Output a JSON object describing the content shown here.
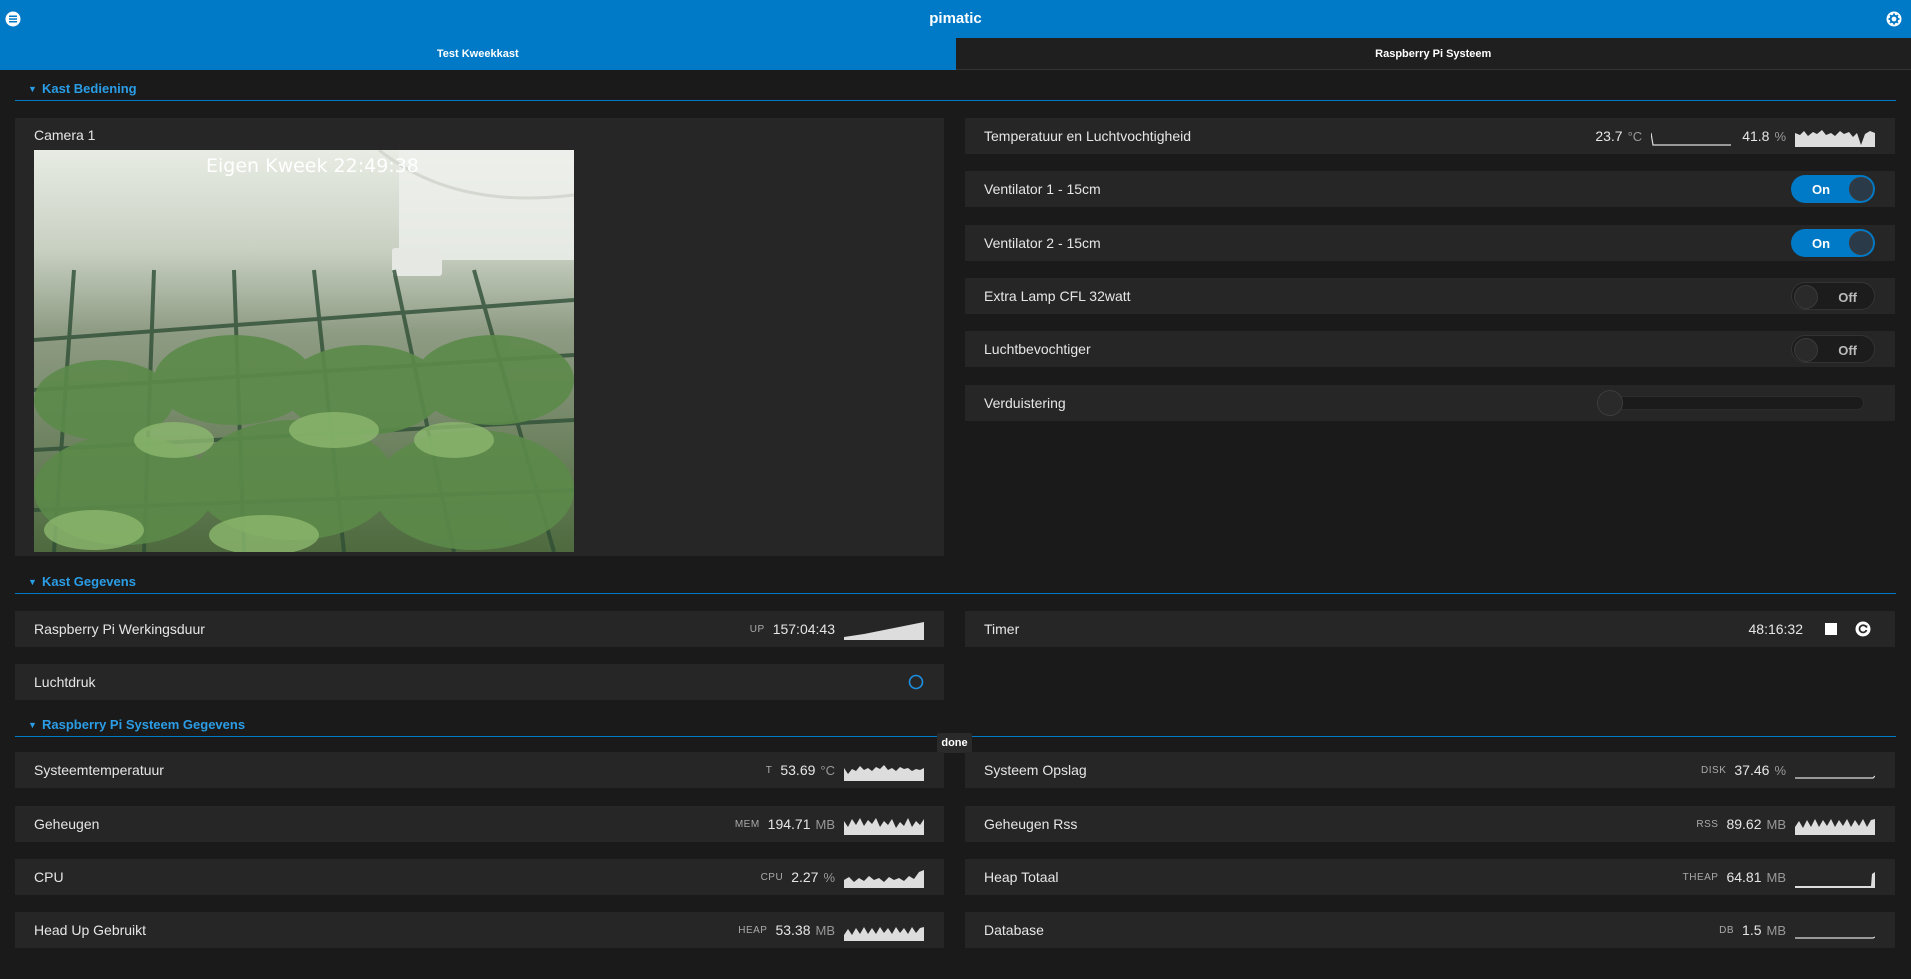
{
  "header": {
    "title": "pimatic",
    "menu_icon": "menu-icon",
    "settings_icon": "gear-icon"
  },
  "tabs": [
    {
      "label": "Test Kweekkast",
      "active": true
    },
    {
      "label": "Raspberry Pi Systeem",
      "active": false
    }
  ],
  "sections": {
    "kast_bediening": "Kast Bediening",
    "kast_gegevens": "Kast Gegevens",
    "pi_gegevens": "Raspberry Pi Systeem Gegevens"
  },
  "camera": {
    "label": "Camera 1",
    "overlay_text": "Eigen Kweek  22:49:38"
  },
  "temp_hum": {
    "label": "Temperatuur en Luchtvochtigheid",
    "temperature": "23.7",
    "temp_unit": "°C",
    "humidity": "41.8",
    "hum_unit": "%"
  },
  "switches": [
    {
      "label": "Ventilator 1 - 15cm",
      "state": "On"
    },
    {
      "label": "Ventilator 2 - 15cm",
      "state": "On"
    },
    {
      "label": "Extra Lamp CFL 32watt",
      "state": "Off"
    },
    {
      "label": "Luchtbevochtiger",
      "state": "Off"
    }
  ],
  "dimmer": {
    "label": "Verduistering",
    "level": 0
  },
  "uptime": {
    "label": "Raspberry Pi Werkingsduur",
    "acronym": "UP",
    "value": "157:04:43"
  },
  "timer": {
    "label": "Timer",
    "value": "48:16:32",
    "stop_icon": "stop-icon",
    "reset_icon": "refresh-icon"
  },
  "luchtdruk": {
    "label": "Luchtdruk",
    "icon": "loading-circle-icon"
  },
  "tooltip": {
    "text": "done"
  },
  "system_left": [
    {
      "label": "Systeemtemperatuur",
      "acronym": "T",
      "value": "53.69",
      "unit": "°C"
    },
    {
      "label": "Geheugen",
      "acronym": "MEM",
      "value": "194.71",
      "unit": "MB"
    },
    {
      "label": "CPU",
      "acronym": "CPU",
      "value": "2.27",
      "unit": "%"
    },
    {
      "label": "Head Up Gebruikt",
      "acronym": "HEAP",
      "value": "53.38",
      "unit": "MB"
    }
  ],
  "system_right": [
    {
      "label": "Systeem Opslag",
      "acronym": "DISK",
      "value": "37.46",
      "unit": "%"
    },
    {
      "label": "Geheugen Rss",
      "acronym": "RSS",
      "value": "89.62",
      "unit": "MB"
    },
    {
      "label": "Heap Totaal",
      "acronym": "THEAP",
      "value": "64.81",
      "unit": "MB"
    },
    {
      "label": "Database",
      "acronym": "DB",
      "value": "1.5",
      "unit": "MB"
    }
  ],
  "colors": {
    "accent": "#0079c6",
    "background": "#1a1a1a",
    "card": "#262626"
  }
}
